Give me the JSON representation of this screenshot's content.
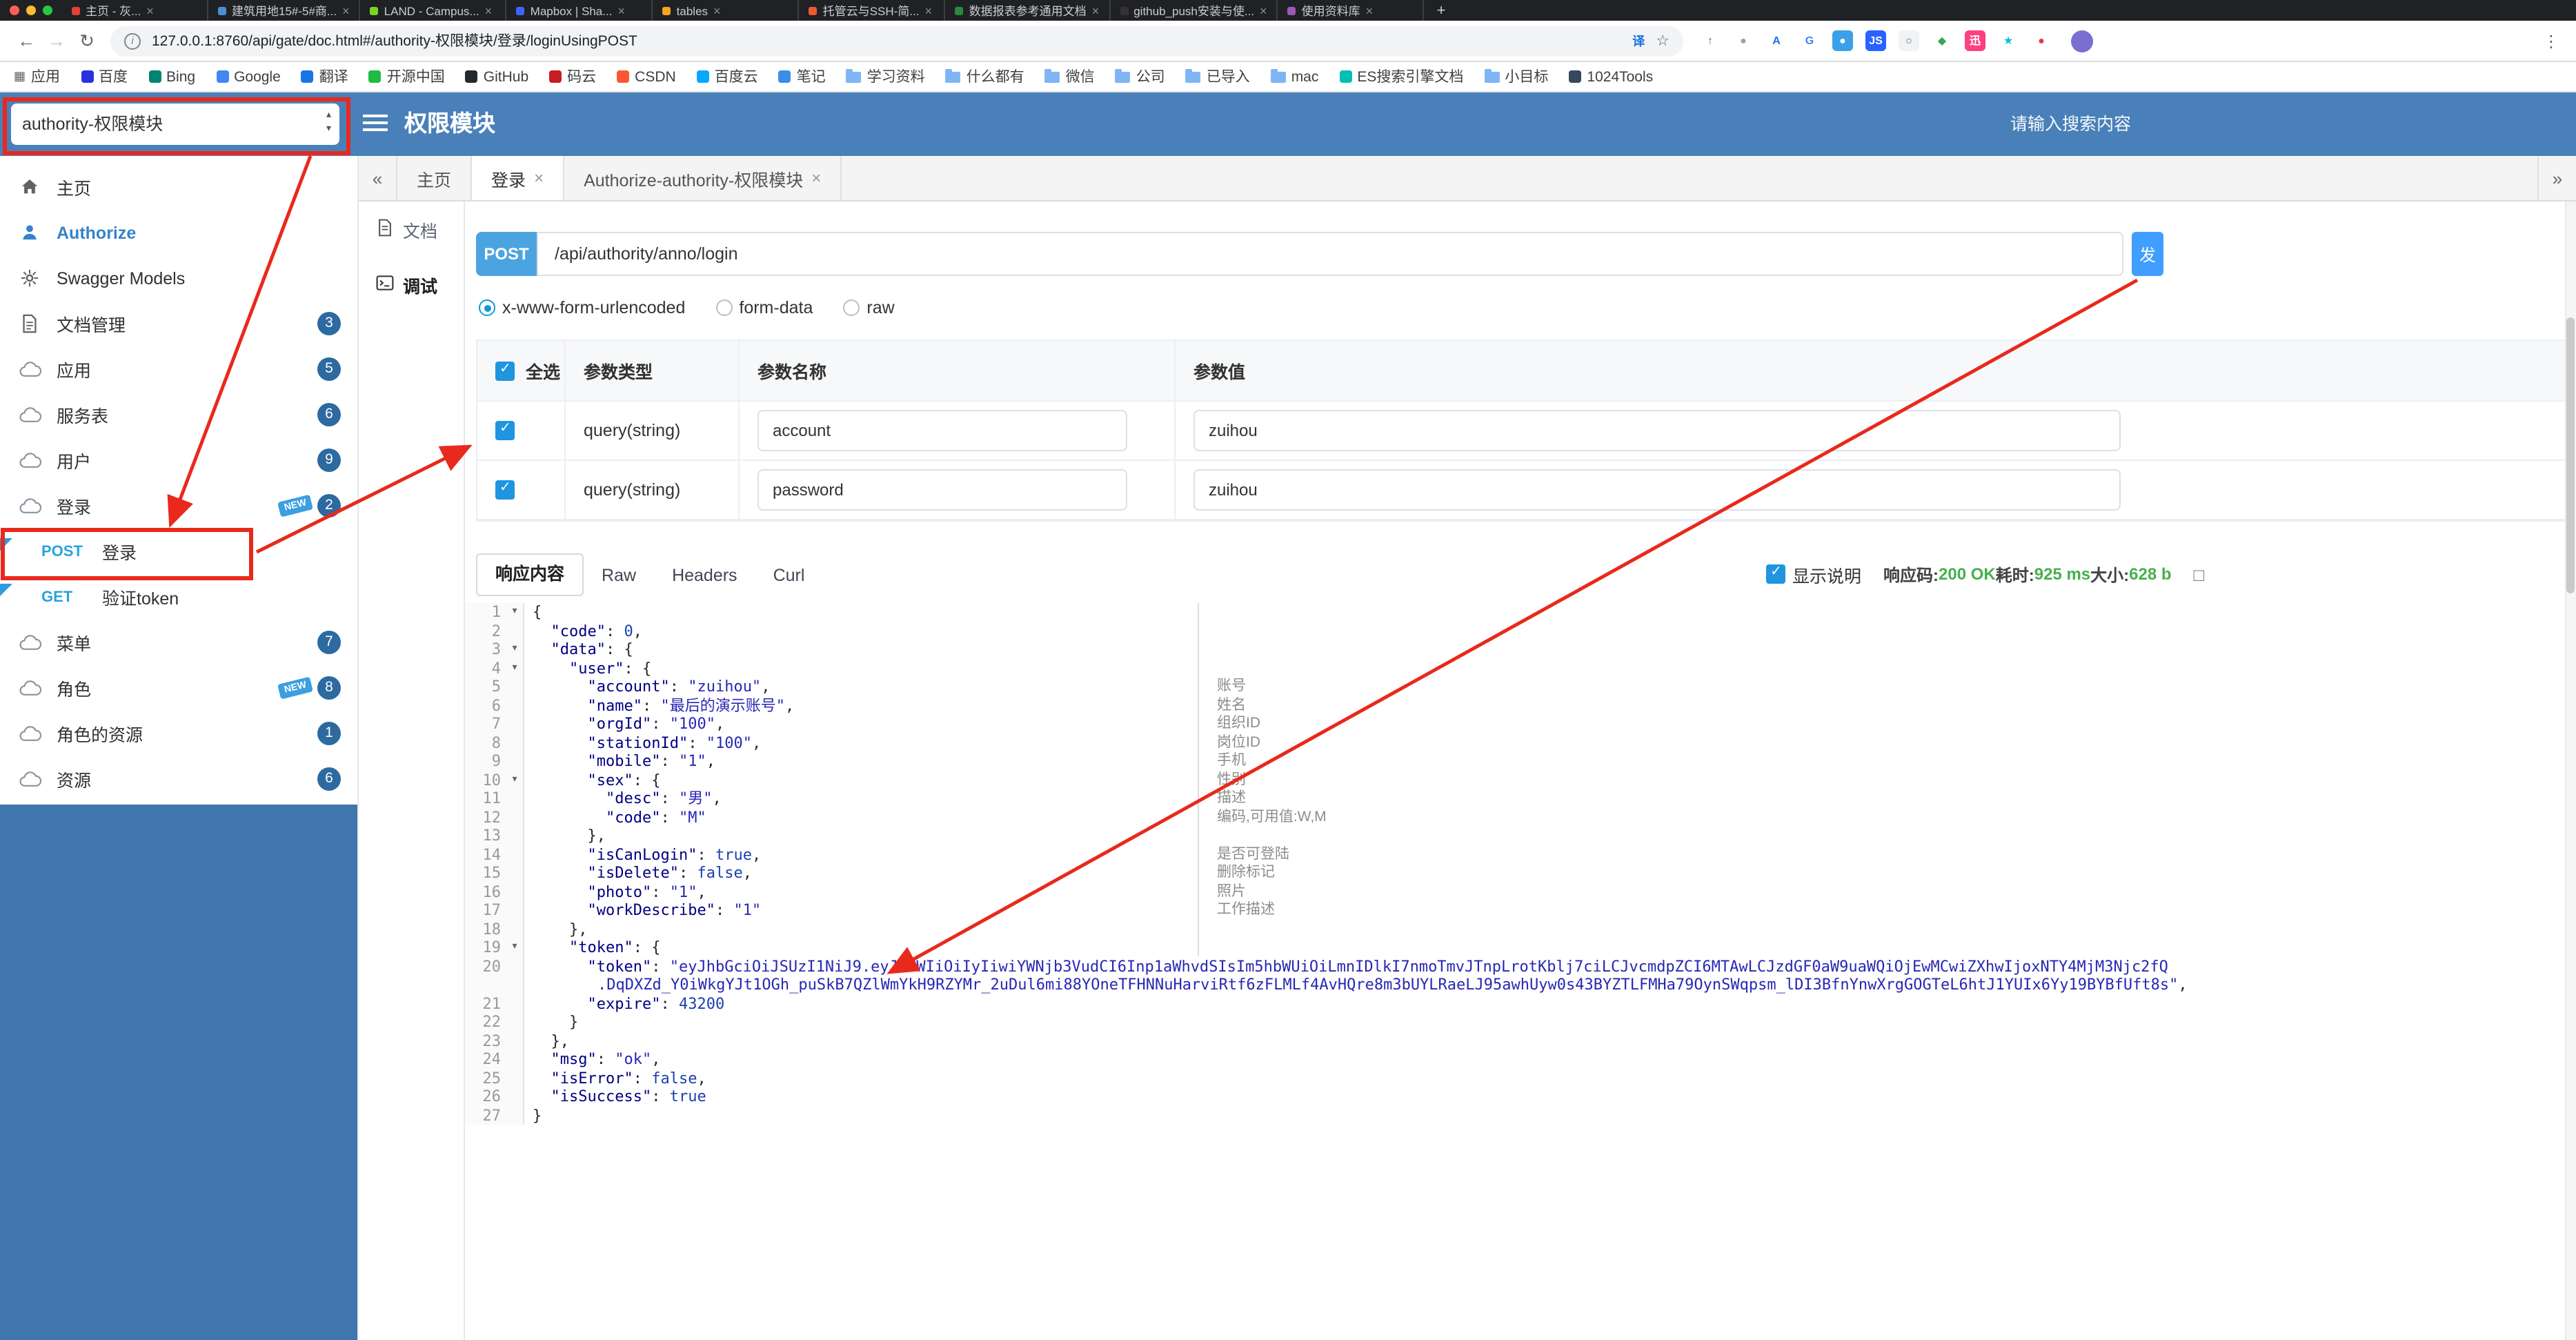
{
  "browser": {
    "traffic_lights": [
      "#ff5f57",
      "#febc2e",
      "#28c840"
    ],
    "tabs": [
      {
        "title": "主页 - 灰...",
        "color": "#e34133"
      },
      {
        "title": "建筑用地15#-5#商...",
        "color": "#4a90d9"
      },
      {
        "title": "LAND - Campus...",
        "color": "#7ed321"
      },
      {
        "title": "Mapbox | Sha...",
        "color": "#4264fb"
      },
      {
        "title": "tables",
        "color": "#f5a623"
      },
      {
        "title": "托管云与SSH-简...",
        "color": "#ea5a31"
      },
      {
        "title": "数据报表参考通用文档",
        "color": "#2b8a3e"
      },
      {
        "title": "github_push安装与使...",
        "color": "#333333"
      },
      {
        "title": "使用资料库",
        "color": "#9b59b6"
      }
    ],
    "new_tab_glyph": "+",
    "nav": {
      "back": "←",
      "forward": "→",
      "refresh": "↻"
    },
    "address": {
      "info_glyph": "i",
      "url": "127.0.0.1:8760/api/gate/doc.html#/authority-权限模块/登录/loginUsingPOST",
      "translate_glyph": "译",
      "star_glyph": "☆"
    },
    "toolbar_icons": [
      {
        "name": "share-icon",
        "glyph": "↑",
        "bg": "#ffffff",
        "color": "#5f6368"
      },
      {
        "name": "history-icon",
        "glyph": "●",
        "bg": "#ffffff",
        "color": "#9aa0a6"
      },
      {
        "name": "translate-ext-icon",
        "glyph": "A",
        "bg": "#ffffff",
        "color": "#1a73e8"
      },
      {
        "name": "google-icon",
        "glyph": "G",
        "bg": "#ffffff",
        "color": "#4285f4"
      },
      {
        "name": "screenshot-icon",
        "glyph": "●",
        "bg": "#3aa0e8",
        "color": "#ffffff"
      },
      {
        "name": "json-formatter-icon",
        "glyph": "JS",
        "bg": "#2962ff",
        "color": "#ffffff"
      },
      {
        "name": "octotree-icon",
        "glyph": "○",
        "bg": "#f1f3f4",
        "color": "#666666"
      },
      {
        "name": "shield-icon",
        "glyph": "◆",
        "bg": "#ffffff",
        "color": "#34a853"
      },
      {
        "name": "xunlei-icon",
        "glyph": "迅",
        "bg": "#ff4081",
        "color": "#ffffff"
      },
      {
        "name": "evernote-icon",
        "glyph": "★",
        "bg": "#ffffff",
        "color": "#00bcd4"
      },
      {
        "name": "notification-icon",
        "glyph": "●",
        "bg": "#ffffff",
        "color": "#e53935"
      }
    ],
    "menu_glyph": "⋮",
    "bookmarks": [
      {
        "label": "应用",
        "icon": "apps"
      },
      {
        "label": "百度",
        "icon": "site",
        "color": "#2932e1"
      },
      {
        "label": "Bing",
        "icon": "site",
        "color": "#008373"
      },
      {
        "label": "Google",
        "icon": "site",
        "color": "#4285f4"
      },
      {
        "label": "翻译",
        "icon": "site",
        "color": "#1a73e8"
      },
      {
        "label": "开源中国",
        "icon": "site",
        "color": "#21ba45"
      },
      {
        "label": "GitHub",
        "icon": "site",
        "color": "#24292e"
      },
      {
        "label": "码云",
        "icon": "site",
        "color": "#c71d23"
      },
      {
        "label": "CSDN",
        "icon": "site",
        "color": "#fc5531"
      },
      {
        "label": "百度云",
        "icon": "site",
        "color": "#06a7ff"
      },
      {
        "label": "笔记",
        "icon": "site",
        "color": "#3a8ee6"
      },
      {
        "label": "学习资料",
        "icon": "folder"
      },
      {
        "label": "什么都有",
        "icon": "folder"
      },
      {
        "label": "微信",
        "icon": "folder"
      },
      {
        "label": "公司",
        "icon": "folder"
      },
      {
        "label": "已导入",
        "icon": "folder"
      },
      {
        "label": "mac",
        "icon": "folder"
      },
      {
        "label": "ES搜索引擎文档",
        "icon": "site",
        "color": "#00bfb3"
      },
      {
        "label": "小目标",
        "icon": "folder"
      },
      {
        "label": "1024Tools",
        "icon": "site",
        "color": "#34495e"
      }
    ]
  },
  "header": {
    "module_select": "authority-权限模块",
    "title": "权限模块",
    "search_placeholder": "请输入搜索内容"
  },
  "sidebar": {
    "new_tag": "NEW",
    "items": [
      {
        "key": "home",
        "icon": "home",
        "label": "主页"
      },
      {
        "key": "authorize",
        "icon": "authorize",
        "label": "Authorize",
        "active": true
      },
      {
        "key": "swagger-models",
        "icon": "models",
        "label": "Swagger Models"
      },
      {
        "key": "doc-manage",
        "icon": "docs",
        "label": "文档管理",
        "badge": "3"
      },
      {
        "key": "application",
        "icon": "cloud",
        "label": "应用",
        "badge": "5"
      },
      {
        "key": "service",
        "icon": "cloud",
        "label": "服务表",
        "badge": "6"
      },
      {
        "key": "user",
        "icon": "cloud",
        "label": "用户",
        "badge": "9"
      },
      {
        "key": "login",
        "icon": "cloud",
        "label": "登录",
        "badge": "2",
        "isNew": true,
        "children": [
          {
            "key": "login-post",
            "method": "POST",
            "label": "登录"
          },
          {
            "key": "verify-token-get",
            "method": "GET",
            "label": "验证token"
          }
        ]
      },
      {
        "key": "menu",
        "icon": "cloud",
        "label": "菜单",
        "badge": "7"
      },
      {
        "key": "role",
        "icon": "cloud",
        "label": "角色",
        "badge": "8",
        "isNew": true
      },
      {
        "key": "role-resource",
        "icon": "cloud",
        "label": "角色的资源",
        "badge": "1"
      },
      {
        "key": "resource",
        "icon": "cloud",
        "label": "资源",
        "badge": "6"
      }
    ]
  },
  "doc_tabs": {
    "left_glyph": "«",
    "right_glyph": "»",
    "close_glyph": "×",
    "tabs": [
      {
        "label": "主页",
        "closable": false,
        "active": false
      },
      {
        "label": "登录",
        "closable": true,
        "active": true
      },
      {
        "label": "Authorize-authority-权限模块",
        "closable": true,
        "active": false
      }
    ]
  },
  "panel_tabs": [
    {
      "key": "doc",
      "label": "文档",
      "active": false
    },
    {
      "key": "debug",
      "label": "调试",
      "active": true
    }
  ],
  "debug": {
    "method": "POST",
    "url": "/api/authority/anno/login",
    "send_label": "发",
    "content_types": [
      {
        "label": "x-www-form-urlencoded",
        "selected": true
      },
      {
        "label": "form-data",
        "selected": false
      },
      {
        "label": "raw",
        "selected": false
      }
    ],
    "table": {
      "select_all": "全选",
      "headers": [
        "参数类型",
        "参数名称",
        "参数值"
      ],
      "rows": [
        {
          "checked": true,
          "type": "query(string)",
          "name": "account",
          "value": "zuihou"
        },
        {
          "checked": true,
          "type": "query(string)",
          "name": "password",
          "value": "zuihou"
        }
      ]
    }
  },
  "response": {
    "tabs": [
      {
        "label": "响应内容",
        "active": true
      },
      {
        "label": "Raw",
        "active": false
      },
      {
        "label": "Headers",
        "active": false
      },
      {
        "label": "Curl",
        "active": false
      }
    ],
    "show_desc": "显示说明",
    "fullscreen_glyph": "□",
    "status": [
      {
        "label": "响应码:",
        "value": "200 OK"
      },
      {
        "label": "耗时:",
        "value": "925 ms"
      },
      {
        "label": "大小:",
        "value": "628 b"
      }
    ]
  },
  "code": {
    "fold_glyph": "▾",
    "lines": [
      {
        "n": 1,
        "fold": true,
        "t": "{"
      },
      {
        "n": 2,
        "t": "  \"code\": 0,"
      },
      {
        "n": 3,
        "fold": true,
        "t": "  \"data\": {"
      },
      {
        "n": 4,
        "fold": true,
        "t": "    \"user\": {"
      },
      {
        "n": 5,
        "t": "      \"account\": \"zuihou\",",
        "note": "账号"
      },
      {
        "n": 6,
        "t": "      \"name\": \"最后的演示账号\",",
        "note": "姓名"
      },
      {
        "n": 7,
        "t": "      \"orgId\": \"100\",",
        "note": "组织ID"
      },
      {
        "n": 8,
        "t": "      \"stationId\": \"100\",",
        "note": "岗位ID"
      },
      {
        "n": 9,
        "t": "      \"mobile\": \"1\",",
        "note": "手机"
      },
      {
        "n": 10,
        "fold": true,
        "t": "      \"sex\": {",
        "note": "性别"
      },
      {
        "n": 11,
        "t": "        \"desc\": \"男\",",
        "note": "描述"
      },
      {
        "n": 12,
        "t": "        \"code\": \"M\"",
        "note": "编码,可用值:W,M"
      },
      {
        "n": 13,
        "t": "      },"
      },
      {
        "n": 14,
        "t": "      \"isCanLogin\": true,",
        "note": "是否可登陆"
      },
      {
        "n": 15,
        "t": "      \"isDelete\": false,",
        "note": "删除标记"
      },
      {
        "n": 16,
        "t": "      \"photo\": \"1\",",
        "note": "照片"
      },
      {
        "n": 17,
        "t": "      \"workDescribe\": \"1\"",
        "note": "工作描述"
      },
      {
        "n": 18,
        "t": "    },"
      },
      {
        "n": 19,
        "fold": true,
        "t": "    \"token\": {"
      },
      {
        "n": 20,
        "segs": [
          {
            "t": "      ",
            "c": "pn"
          },
          {
            "t": "\"token\"",
            "c": "key"
          },
          {
            "t": ": ",
            "c": "pn"
          },
          {
            "t": "\"eyJhbGciOiJSUzI1NiJ9.eyJzdWIiOiIyIiwiYWNjb3VudCI6Inp1aWhvdSIsIm5hbWUiOiLmnIDlkI7nmoTmvJTnpLrotKblj7ciLCJvcmdpZCI6MTAwLCJzdGF0aW9uaWQiOjEwMCwiZXhwIjoxNTY4MjM3Njc2fQ",
            "c": "str"
          }
        ]
      },
      {
        "cont": true,
        "segs": [
          {
            "t": ".DqDXZd_Y0iWkgYJt1OGh_puSkB7QZlWmYkH9RZYMr_2uDul6mi88YOneTFHNNuHarviRtf6zFLMLf4AvHQre8m3bUYLRaeLJ95awhUyw0s43BYZTLFMHa79OynSWqpsm_lDI3BfnYnwXrgGOGTeL6htJ1YUIx6Yy19BYBfUft8s\"",
            "c": "str"
          },
          {
            "t": ",",
            "c": "pn"
          }
        ]
      },
      {
        "n": 21,
        "t": "      \"expire\": 43200"
      },
      {
        "n": 22,
        "t": "    }"
      },
      {
        "n": 23,
        "t": "  },"
      },
      {
        "n": 24,
        "t": "  \"msg\": \"ok\","
      },
      {
        "n": 25,
        "t": "  \"isError\": false,"
      },
      {
        "n": 26,
        "t": "  \"isSuccess\": true"
      },
      {
        "n": 27,
        "t": "}"
      }
    ]
  },
  "colors": {
    "accent": "#409eff",
    "header_blue": "#4a80b9",
    "sidebar_fill": "#4176ac",
    "annotation_red": "#e8291c",
    "status_green": "#47b04b",
    "badge_blue": "#2c6aa0"
  }
}
